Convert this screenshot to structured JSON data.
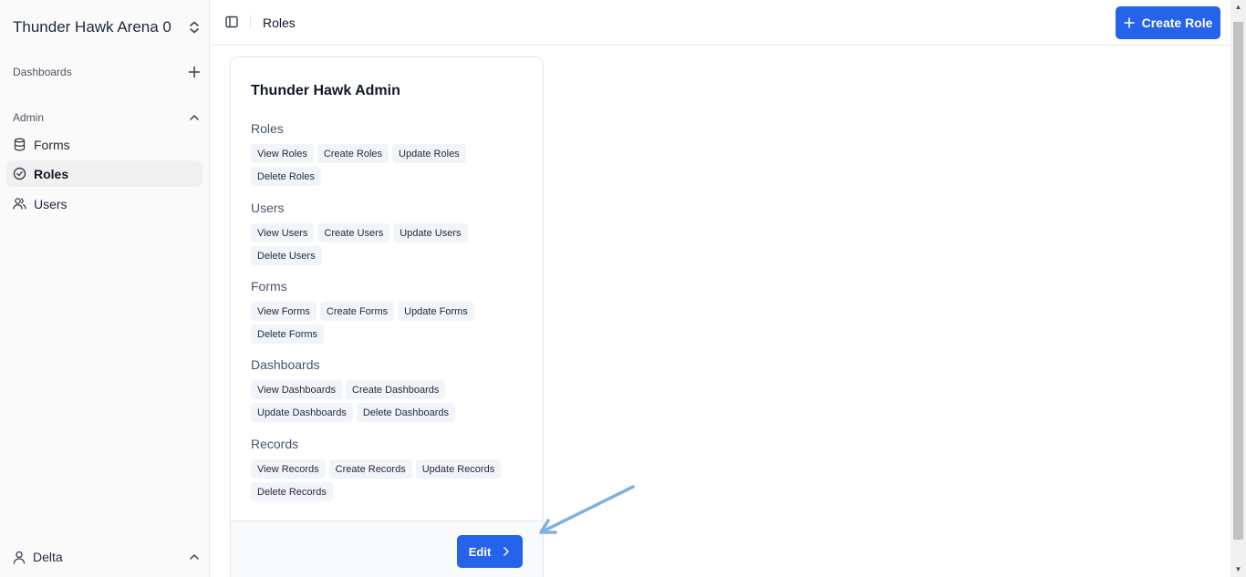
{
  "sidebar": {
    "workspace_name": "Thunder Hawk Arena 0",
    "dashboards_label": "Dashboards",
    "admin_label": "Admin",
    "items": [
      {
        "label": "Forms",
        "icon": "database-icon"
      },
      {
        "label": "Roles",
        "icon": "check-circle-icon",
        "active": true
      },
      {
        "label": "Users",
        "icon": "users-icon"
      }
    ],
    "user_name": "Delta"
  },
  "header": {
    "page_title": "Roles",
    "create_role_label": "Create Role"
  },
  "role_card": {
    "title": "Thunder Hawk Admin",
    "groups": [
      {
        "title": "Roles",
        "permissions": [
          "View Roles",
          "Create Roles",
          "Update Roles",
          "Delete Roles"
        ]
      },
      {
        "title": "Users",
        "permissions": [
          "View Users",
          "Create Users",
          "Update Users",
          "Delete Users"
        ]
      },
      {
        "title": "Forms",
        "permissions": [
          "View Forms",
          "Create Forms",
          "Update Forms",
          "Delete Forms"
        ]
      },
      {
        "title": "Dashboards",
        "permissions": [
          "View Dashboards",
          "Create Dashboards",
          "Update Dashboards",
          "Delete Dashboards"
        ]
      },
      {
        "title": "Records",
        "permissions": [
          "View Records",
          "Create Records",
          "Update Records",
          "Delete Records"
        ]
      }
    ],
    "edit_label": "Edit"
  },
  "colors": {
    "accent": "#2563eb",
    "chip_bg": "#f1f5f9",
    "annotation_arrow": "#7fb2de"
  }
}
